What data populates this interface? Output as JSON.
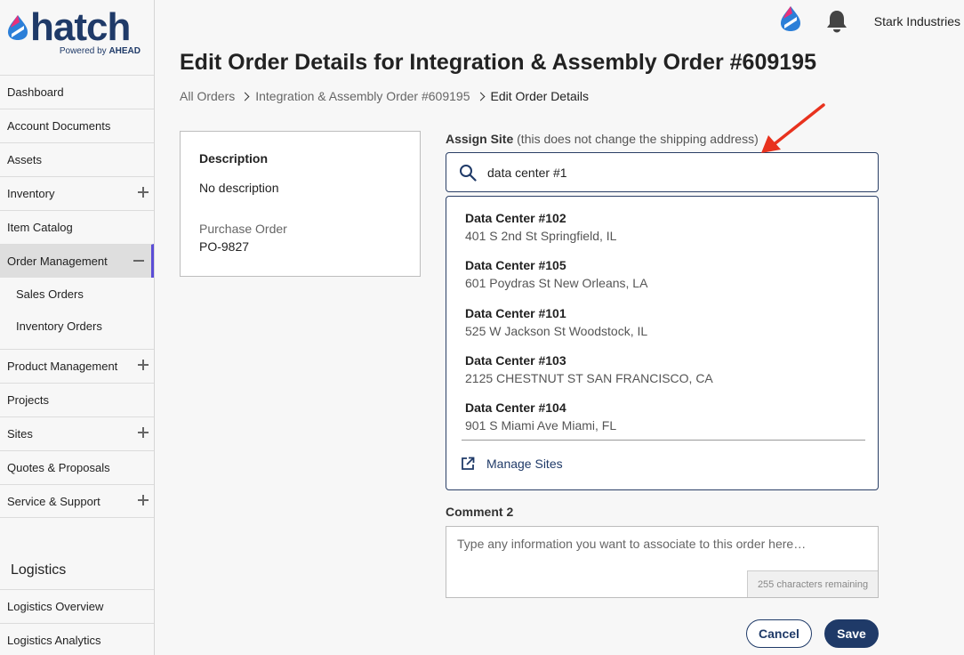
{
  "brand": {
    "name": "hatch",
    "powered_by": "Powered by",
    "powered_brand": "AHEAD"
  },
  "header": {
    "org_name": "Stark Industries"
  },
  "sidebar": {
    "items": [
      {
        "label": "Dashboard"
      },
      {
        "label": "Account Documents"
      },
      {
        "label": "Assets"
      },
      {
        "label": "Inventory"
      },
      {
        "label": "Item Catalog"
      },
      {
        "label": "Order Management"
      },
      {
        "label": "Product Management"
      },
      {
        "label": "Projects"
      },
      {
        "label": "Sites"
      },
      {
        "label": "Quotes & Proposals"
      },
      {
        "label": "Service & Support"
      }
    ],
    "sub_items": [
      {
        "label": "Sales Orders"
      },
      {
        "label": "Inventory Orders"
      }
    ],
    "section_title": "Logistics",
    "logistics_items": [
      {
        "label": "Logistics Overview"
      },
      {
        "label": "Logistics Analytics"
      }
    ]
  },
  "page": {
    "title": "Edit Order Details for Integration & Assembly Order #609195",
    "breadcrumb": [
      "All Orders",
      "Integration & Assembly Order #609195",
      "Edit Order Details"
    ]
  },
  "description_card": {
    "label": "Description",
    "value": "No description",
    "po_label": "Purchase Order",
    "po_value": "PO-9827"
  },
  "assign_site": {
    "label": "Assign Site",
    "hint": "(this does not change the shipping address)",
    "search_value": "data center #1",
    "options": [
      {
        "name": "Data Center #102",
        "address": "401 S 2nd St Springfield, IL"
      },
      {
        "name": "Data Center #105",
        "address": "601 Poydras St New Orleans, LA"
      },
      {
        "name": "Data Center #101",
        "address": "525 W Jackson St Woodstock, IL"
      },
      {
        "name": "Data Center #103",
        "address": "2125 CHESTNUT ST SAN FRANCISCO, CA"
      },
      {
        "name": "Data Center #104",
        "address": "901 S Miami Ave Miami, FL"
      }
    ],
    "manage_label": "Manage Sites"
  },
  "comment": {
    "label": "Comment 2",
    "placeholder": "Type any information you want to associate to this order here…",
    "remaining": "255 characters remaining"
  },
  "actions": {
    "cancel": "Cancel",
    "save": "Save"
  },
  "colors": {
    "primary": "#1f3a68",
    "active_indicator": "#5b4dd6",
    "annotation_arrow": "#e8321e"
  }
}
